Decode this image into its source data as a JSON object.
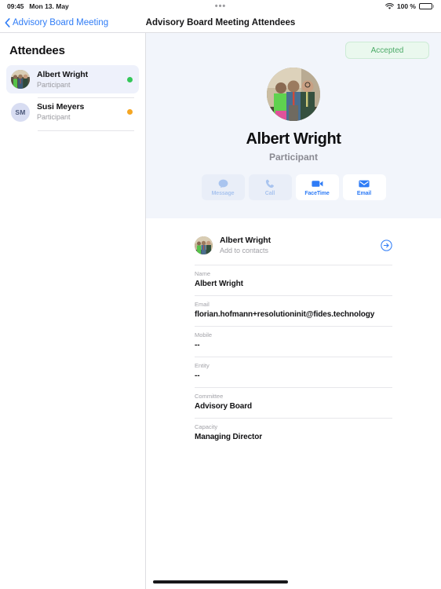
{
  "status_bar": {
    "time": "09:45",
    "date": "Mon 13. May",
    "center_indicator": "•••",
    "wifi_icon": "wifi-icon",
    "battery_percent": "100 %",
    "battery_icon": "battery-full-icon"
  },
  "nav": {
    "back_icon": "chevron-left-icon",
    "back_label": "Advisory Board Meeting",
    "title": "Advisory Board Meeting Attendees"
  },
  "sidebar": {
    "title": "Attendees",
    "items": [
      {
        "name": "Albert Wright",
        "role": "Participant",
        "avatar_type": "photo",
        "avatar_initials": "",
        "status_color": "#34c759",
        "selected": true
      },
      {
        "name": "Susi Meyers",
        "role": "Participant",
        "avatar_type": "initials",
        "avatar_initials": "SM",
        "status_color": "#f5a623",
        "selected": false
      }
    ]
  },
  "detail": {
    "status_badge": "Accepted",
    "status_badge_color": "#4caa68",
    "avatar_icon": "profile-photo",
    "name": "Albert Wright",
    "role": "Participant",
    "actions": [
      {
        "label": "Message",
        "icon": "message-bubble-icon",
        "enabled": false
      },
      {
        "label": "Call",
        "icon": "phone-icon",
        "enabled": false
      },
      {
        "label": "FaceTime",
        "icon": "video-camera-icon",
        "enabled": true
      },
      {
        "label": "Email",
        "icon": "envelope-icon",
        "enabled": true
      }
    ],
    "contact_card": {
      "name": "Albert Wright",
      "subtitle": "Add to contacts",
      "go_icon": "arrow-right-circle-icon"
    },
    "fields": [
      {
        "label": "Name",
        "value": "Albert Wright"
      },
      {
        "label": "Email",
        "value": "florian.hofmann+resolutioninit@fides.technology"
      },
      {
        "label": "Mobile",
        "value": "--"
      },
      {
        "label": "Entity",
        "value": "--"
      },
      {
        "label": "Committee",
        "value": "Advisory Board"
      },
      {
        "label": "Capacity",
        "value": "Managing Director"
      }
    ]
  },
  "home_indicator": "home-indicator"
}
